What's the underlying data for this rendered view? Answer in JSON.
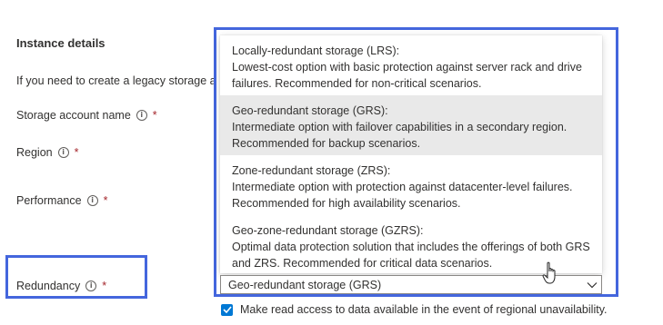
{
  "section": {
    "title": "Instance details"
  },
  "intro": {
    "text": "If you need to create a legacy storage acco"
  },
  "fields": {
    "storage_account_name": {
      "label": "Storage account name",
      "info": "i",
      "required": "*"
    },
    "region": {
      "label": "Region",
      "info": "i",
      "required": "*"
    },
    "performance": {
      "label": "Performance",
      "info": "i",
      "required": "*"
    },
    "redundancy": {
      "label": "Redundancy",
      "info": "i",
      "required": "*"
    }
  },
  "redundancy_dropdown": {
    "selected_value": "Geo-redundant storage (GRS)",
    "options": [
      {
        "title": "Locally-redundant storage (LRS):",
        "desc_line1": "Lowest-cost option with basic protection against server rack and drive",
        "desc_line2": "failures. Recommended for non-critical scenarios."
      },
      {
        "title": "Geo-redundant storage (GRS):",
        "desc_line1": "Intermediate option with failover capabilities in a secondary region.",
        "desc_line2": "Recommended for backup scenarios."
      },
      {
        "title": "Zone-redundant storage (ZRS):",
        "desc_line1": "Intermediate option with protection against datacenter-level failures.",
        "desc_line2": "Recommended for high availability scenarios."
      },
      {
        "title": "Geo-zone-redundant storage (GZRS):",
        "desc_line1": "Optimal data protection solution that includes the offerings of both GRS",
        "desc_line2": "and ZRS. Recommended for critical data scenarios."
      }
    ]
  },
  "read_access_checkbox": {
    "label": "Make read access to data available in the event of regional unavailability.",
    "checked": true
  },
  "colors": {
    "highlight": "#4466dd",
    "accent": "#0078d4",
    "required": "#a4262c",
    "selected_option_bg": "#e9e9e9"
  },
  "icons": {
    "info": "info-icon",
    "chevron": "chevron-down-icon",
    "check": "checkmark-icon",
    "cursor": "hand-pointer-icon"
  }
}
